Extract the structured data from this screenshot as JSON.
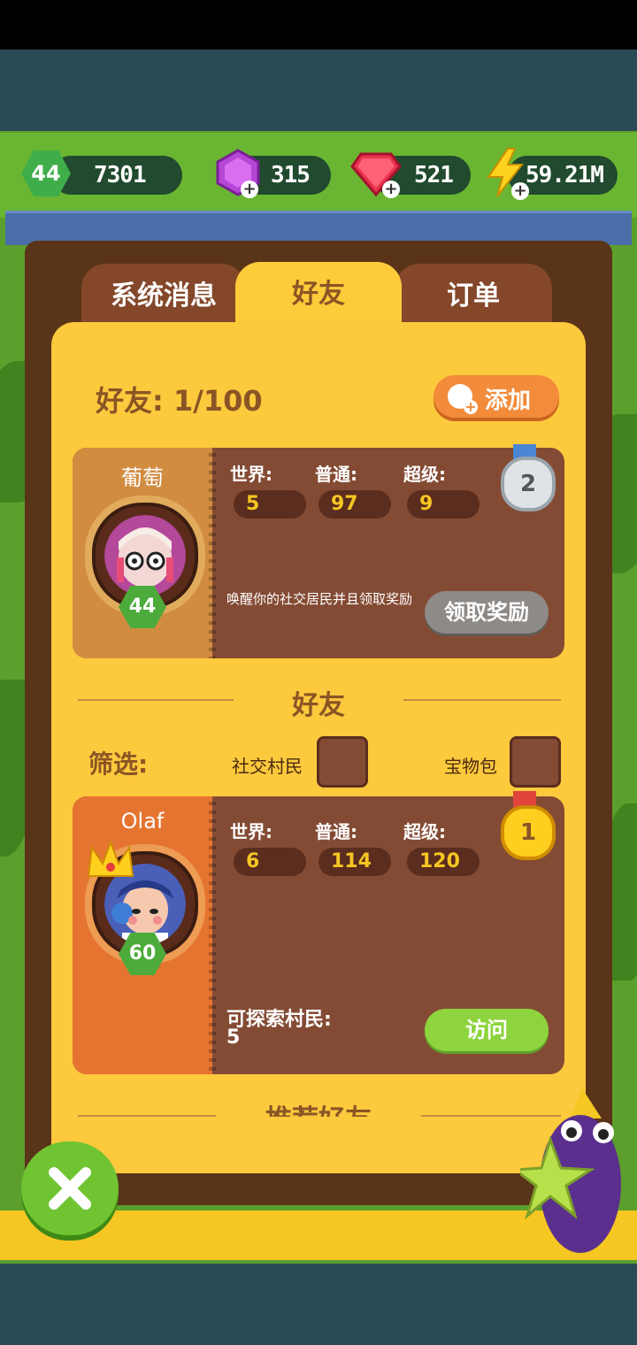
{
  "hud": {
    "level": "44",
    "coins": "7301",
    "purple_gems": "315",
    "red_gems": "521",
    "energy": "59.21M"
  },
  "tabs": [
    {
      "label": "系统消息",
      "active": false
    },
    {
      "label": "好友",
      "active": true
    },
    {
      "label": "订单",
      "active": false
    }
  ],
  "friends": {
    "count_label": "好友: 1/100",
    "add_label": "添加"
  },
  "self_card": {
    "name": "葡萄",
    "level": "44",
    "stats": [
      {
        "label": "世界:",
        "value": "5"
      },
      {
        "label": "普通:",
        "value": "97"
      },
      {
        "label": "超级:",
        "value": "9"
      }
    ],
    "rank": "2",
    "hint": "唤醒你的社交居民并且领取奖励",
    "button": "领取奖励"
  },
  "friends_section": {
    "title": "好友",
    "filter_label": "筛选:",
    "options": [
      "社交村民",
      "宝物包"
    ]
  },
  "friend_card": {
    "name": "Olaf",
    "level": "60",
    "stats": [
      {
        "label": "世界:",
        "value": "6"
      },
      {
        "label": "普通:",
        "value": "114"
      },
      {
        "label": "超级:",
        "value": "120"
      }
    ],
    "rank": "1",
    "explore_label": "可探索村民:",
    "explore_value": "5",
    "button": "访问"
  },
  "recommended_section": {
    "title": "推荐好友"
  },
  "colors": {
    "panel": "#fdc93d",
    "card": "#844b34",
    "accent_green": "#8dd43e",
    "accent_orange": "#f28b3a"
  }
}
